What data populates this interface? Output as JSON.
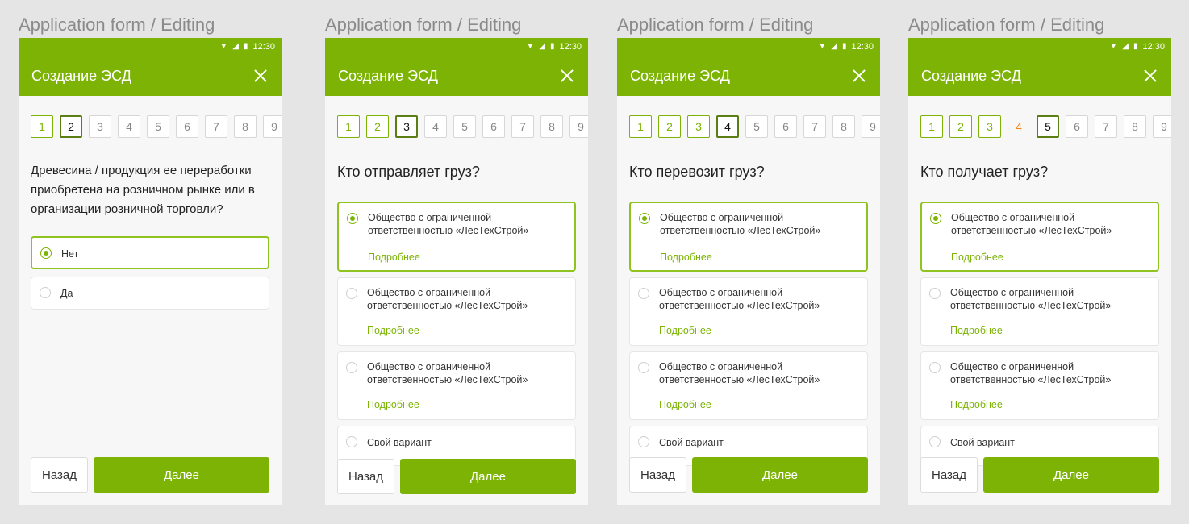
{
  "frame_title": "Application form / Editing",
  "status_time": "12:30",
  "app_title": "Создание ЭСД",
  "screens": [
    {
      "steps": [
        "1",
        "2",
        "3",
        "4",
        "5",
        "6",
        "7",
        "8",
        "9"
      ],
      "question": "Древесина / продукция ее переработки приобретена на розничном рынке или в организации розничной торговли?",
      "options": [
        "Нет",
        "Да"
      ]
    },
    {
      "steps": [
        "1",
        "2",
        "3",
        "4",
        "5",
        "6",
        "7",
        "8",
        "9"
      ],
      "question": "Кто отправляет груз?",
      "options": [
        "Общество с ограниченной ответственностью «ЛесТехСтрой»",
        "Общество с ограниченной ответственностью «ЛесТехСтрой»",
        "Общество с ограниченной ответственностью «ЛесТехСтрой»",
        "Свой вариант"
      ]
    },
    {
      "steps": [
        "1",
        "2",
        "3",
        "4",
        "5",
        "6",
        "7",
        "8",
        "9"
      ],
      "question": "Кто перевозит груз?",
      "options": [
        "Общество с ограниченной ответственностью «ЛесТехСтрой»",
        "Общество с ограниченной ответственностью «ЛесТехСтрой»",
        "Общество с ограниченной ответственностью «ЛесТехСтрой»",
        "Свой вариант"
      ]
    },
    {
      "steps": [
        "1",
        "2",
        "3",
        "4",
        "5",
        "6",
        "7",
        "8",
        "9"
      ],
      "question": "Кто получает груз?",
      "options": [
        "Общество с ограниченной ответственностью «ЛесТехСтрой»",
        "Общество с ограниченной ответственностью «ЛесТехСтрой»",
        "Общество с ограниченной ответственностью «ЛесТехСтрой»",
        "Свой вариант"
      ]
    }
  ],
  "details_link": "Подробнее",
  "back_label": "Назад",
  "next_label": "Далее",
  "colors": {
    "primary": "#7cb305",
    "warning": "#ef8a1a"
  }
}
